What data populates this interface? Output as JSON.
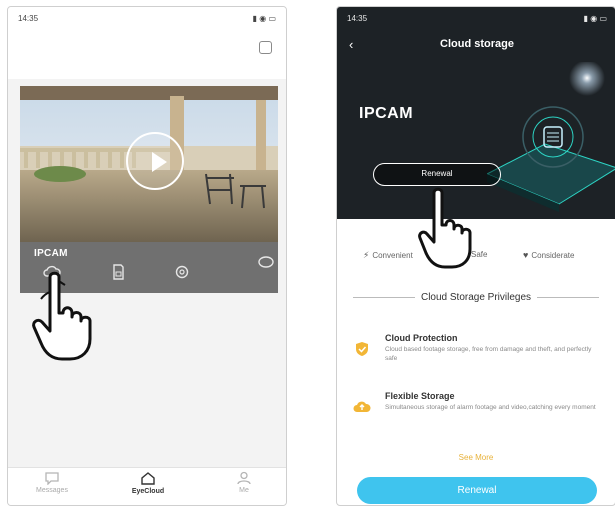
{
  "left_phone": {
    "status_time": "14:35",
    "status_indicators": "▮ ◉ ▭",
    "camera_name": "IPCAM",
    "bar_icons": [
      "cloud-icon",
      "sd-card-icon",
      "settings-gear-icon",
      "more-icon"
    ],
    "nav": [
      {
        "label": "Messages",
        "icon": "message-icon"
      },
      {
        "label": "EyeCloud",
        "icon": "home-cloud-icon",
        "active": true
      },
      {
        "label": "Me",
        "icon": "person-icon"
      }
    ]
  },
  "right_phone": {
    "status_time": "14:35",
    "status_indicators": "▮ ◉ ▭",
    "title": "Cloud storage",
    "device_name": "IPCAM",
    "hero_button": "Renewal",
    "features": [
      "Convenient",
      "Safe",
      "Considerate"
    ],
    "privileges_heading": "Cloud Storage Privileges",
    "privileges": [
      {
        "title": "Cloud Protection",
        "description": "Cloud based footage storage, free from damage and theft, and perfectly safe"
      },
      {
        "title": "Flexible Storage",
        "description": "Simultaneous storage of alarm footage and video,catching every moment"
      }
    ],
    "see_more": "See More",
    "primary_button": "Renewal"
  },
  "colors": {
    "accent_blue": "#3fc4ee",
    "see_more_gold": "#e8b23a",
    "privilege_icon_gold": "#f2b636",
    "hero_dark": "#1d2226"
  }
}
